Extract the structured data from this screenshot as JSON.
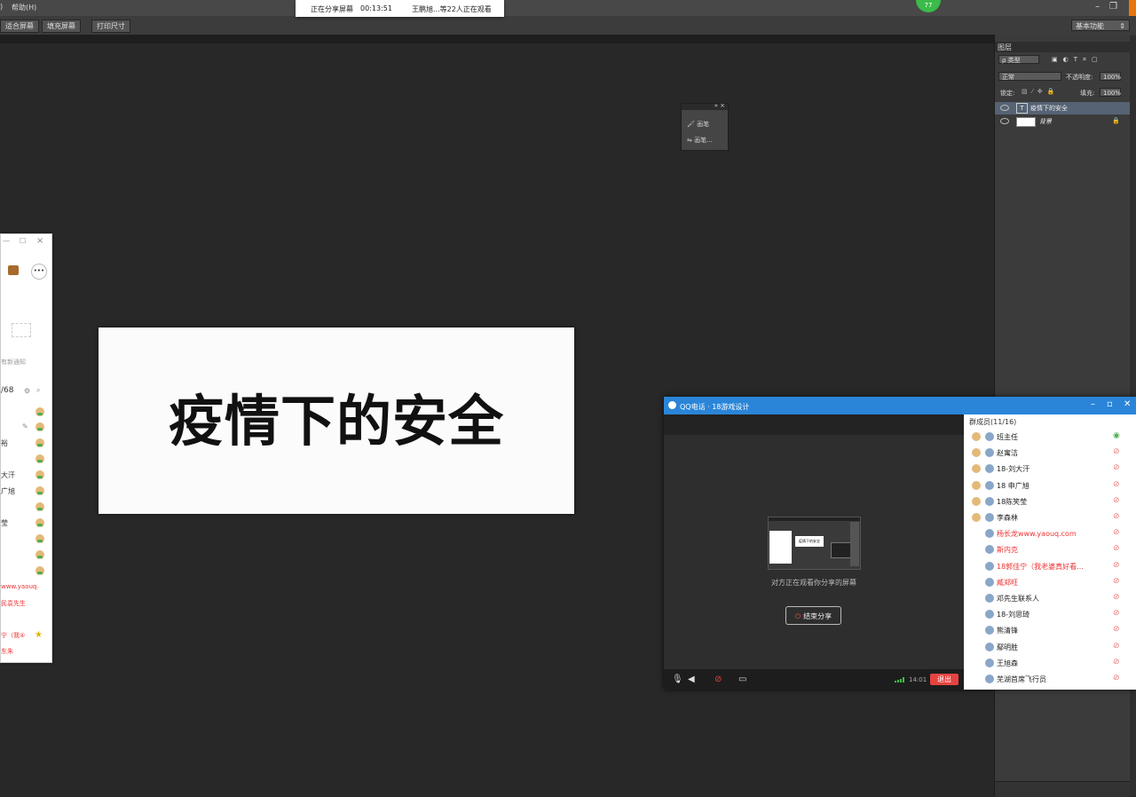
{
  "menubar": {
    "help": "帮助(H)",
    "fragment": ")"
  },
  "options": {
    "fit_screen": "适合屏幕",
    "fill_screen": "填充屏幕",
    "print_size": "打印尺寸",
    "workspace": "基本功能"
  },
  "share_banner": {
    "status": "正在分享屏幕",
    "elapsed": "00:13:51",
    "viewers": "王鹏旭...等22人正在观看"
  },
  "canvas": {
    "text": "疫情下的安全"
  },
  "mini_panel": {
    "item1": "画笔",
    "item2": "画笔..."
  },
  "layers_panel": {
    "tab": "图层",
    "filter_kind": "ρ 类型",
    "blend_mode": "正常",
    "opacity_label": "不透明度:",
    "opacity_value": "100%",
    "lock_label": "锁定:",
    "fill_label": "填充:",
    "fill_value": "100%",
    "layers": [
      {
        "name": "疫情下的安全",
        "kind": "text"
      },
      {
        "name": "背景",
        "kind": "background"
      }
    ]
  },
  "left_window": {
    "notice": "有新通知",
    "count": "/68",
    "names": [
      "裕",
      "大汗",
      "广旭",
      "莹"
    ],
    "link": "www.yaouq.",
    "red1": "民袁先生",
    "red2": "宁（我④",
    "red3": "东朱"
  },
  "qq_call": {
    "title": "QQ电话 · 18游戏设计",
    "watching_text": "对方正在观看你分享的屏幕",
    "stop_share": "结束分享",
    "time": "14:01",
    "exit": "退出",
    "members_header": "群成员(11/16)",
    "members": [
      {
        "name": "班主任",
        "red": false
      },
      {
        "name": "赵寓洁",
        "red": false
      },
      {
        "name": "18-刘大汗",
        "red": false
      },
      {
        "name": "18 申广旭",
        "red": false
      },
      {
        "name": "18陈笑莹",
        "red": false
      },
      {
        "name": "李森林",
        "red": false
      },
      {
        "name": "杨长龙www.yaouq.com",
        "red": true
      },
      {
        "name": "斯内克",
        "red": true
      },
      {
        "name": "18郭佳宁（我老婆真好看...",
        "red": true
      },
      {
        "name": "臧郑旺",
        "red": true
      },
      {
        "name": "邓先生联系人",
        "red": false
      },
      {
        "name": "18-刘思琦",
        "red": false
      },
      {
        "name": "熊清锋",
        "red": false
      },
      {
        "name": "鄢明胜",
        "red": false
      },
      {
        "name": "王旭森",
        "red": false
      },
      {
        "name": "芜湖首席飞行员",
        "red": false
      }
    ],
    "preview_text": "疫情下的安全"
  },
  "colors": {
    "workspace_bg": "#282828",
    "qq_blue": "#2a85d8",
    "exit_red": "#e64340",
    "accent_orange": "#e8740c"
  }
}
